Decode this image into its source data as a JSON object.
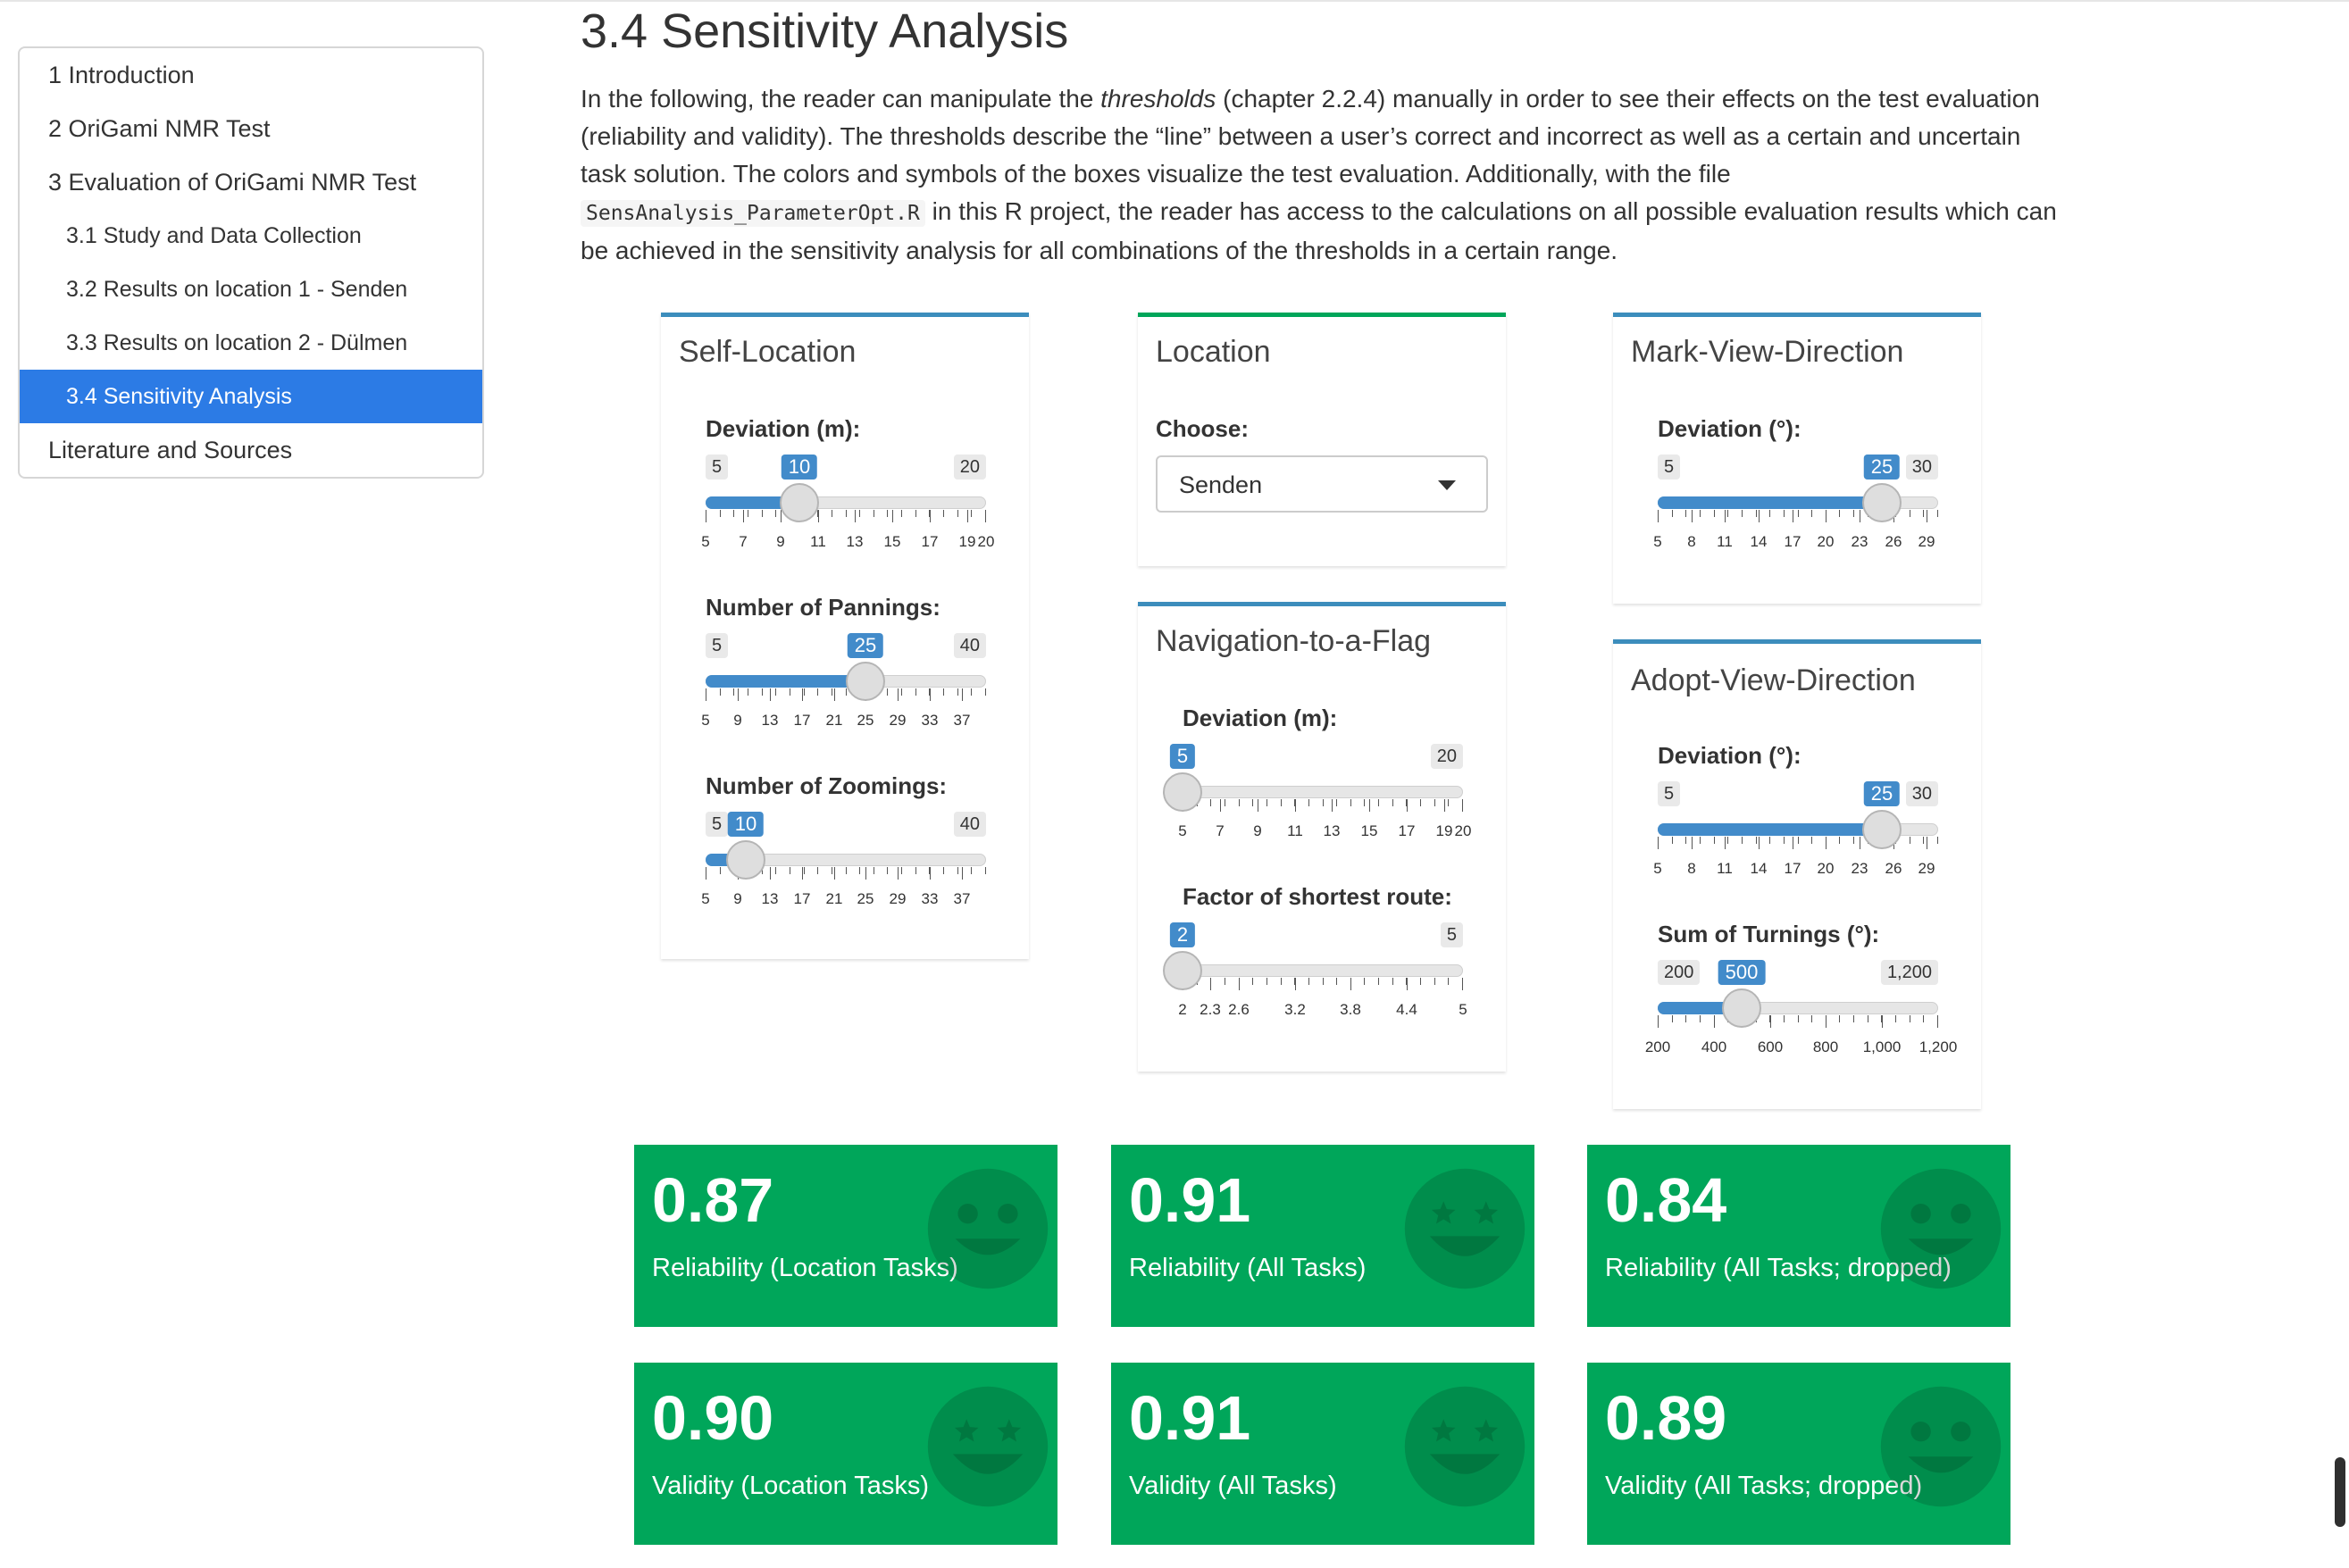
{
  "toc": [
    {
      "label": "1 Introduction",
      "level": 1,
      "active": false
    },
    {
      "label": "2 OriGami NMR Test",
      "level": 1,
      "active": false
    },
    {
      "label": "3 Evaluation of OriGami NMR Test",
      "level": 1,
      "active": false
    },
    {
      "label": "3.1 Study and Data Collection",
      "level": 2,
      "active": false
    },
    {
      "label": "3.2 Results on location 1 - Senden",
      "level": 2,
      "active": false
    },
    {
      "label": "3.3 Results on location 2 - Dülmen",
      "level": 2,
      "active": false
    },
    {
      "label": "3.4 Sensitivity Analysis",
      "level": 2,
      "active": true
    },
    {
      "label": "Literature and Sources",
      "level": 1,
      "active": false
    }
  ],
  "section": {
    "title": "3.4 Sensitivity Analysis",
    "intro": {
      "p1": "In the following, the reader can manipulate the ",
      "em": "thresholds",
      "p2": " (chapter 2.2.4) manually in order to see their effects on the test evaluation (reliability and validity). The thresholds describe the “line” between a user’s correct and incorrect as well as a certain and uncertain task solution. The colors and symbols of the boxes visualize the test evaluation. Additionally, with the file ",
      "code": "SensAnalysis_ParameterOpt.R",
      "p3": " in this R project, the reader has access to the calculations on all possible evaluation results which can be achieved in the sensitivity analysis for all combinations of the thresholds in a certain range."
    }
  },
  "panels": {
    "self_location": {
      "title": "Self-Location",
      "deviation": {
        "label": "Deviation (m):",
        "min": 5,
        "max": 20,
        "value": 10,
        "min_label": "5",
        "max_label": "20",
        "value_label": "10",
        "tick_labels": [
          "5",
          "7",
          "9",
          "11",
          "13",
          "15",
          "17",
          "19",
          "20"
        ],
        "tick_values": [
          5,
          7,
          9,
          11,
          13,
          15,
          17,
          19,
          20
        ]
      },
      "pannings": {
        "label": "Number of Pannings:",
        "min": 5,
        "max": 40,
        "value": 25,
        "min_label": "5",
        "max_label": "40",
        "value_label": "25",
        "tick_labels": [
          "5",
          "9",
          "13",
          "17",
          "21",
          "25",
          "29",
          "33",
          "37"
        ],
        "tick_values": [
          5,
          9,
          13,
          17,
          21,
          25,
          29,
          33,
          37
        ]
      },
      "zoomings": {
        "label": "Number of Zoomings:",
        "min": 5,
        "max": 40,
        "value": 10,
        "min_label": "5",
        "max_label": "40",
        "value_label": "10",
        "tick_labels": [
          "5",
          "9",
          "13",
          "17",
          "21",
          "25",
          "29",
          "33",
          "37"
        ],
        "tick_values": [
          5,
          9,
          13,
          17,
          21,
          25,
          29,
          33,
          37
        ]
      }
    },
    "location": {
      "title": "Location",
      "choose_label": "Choose:",
      "selected": "Senden"
    },
    "nav_flag": {
      "title": "Navigation-to-a-Flag",
      "deviation": {
        "label": "Deviation (m):",
        "min": 5,
        "max": 20,
        "value": 5,
        "min_label": "",
        "max_label": "20",
        "value_label": "5",
        "tick_labels": [
          "5",
          "7",
          "9",
          "11",
          "13",
          "15",
          "17",
          "19",
          "20"
        ],
        "tick_values": [
          5,
          7,
          9,
          11,
          13,
          15,
          17,
          19,
          20
        ]
      },
      "factor": {
        "label": "Factor of shortest route:",
        "min": 2,
        "max": 5,
        "value": 2,
        "min_label": "",
        "max_label": "5",
        "value_label": "2",
        "tick_labels": [
          "2",
          "2.3",
          "2.6",
          "3.2",
          "3.8",
          "4.4",
          "5"
        ],
        "tick_values": [
          2,
          2.3,
          2.6,
          3.2,
          3.8,
          4.4,
          5
        ]
      }
    },
    "mark_view": {
      "title": "Mark-View-Direction",
      "deviation": {
        "label": "Deviation (°):",
        "min": 5,
        "max": 30,
        "value": 25,
        "min_label": "5",
        "max_label": "30",
        "value_label": "25",
        "tick_labels": [
          "5",
          "8",
          "11",
          "14",
          "17",
          "20",
          "23",
          "26",
          "29"
        ],
        "tick_values": [
          5,
          8,
          11,
          14,
          17,
          20,
          23,
          26,
          29
        ]
      }
    },
    "adopt_view": {
      "title": "Adopt-View-Direction",
      "deviation": {
        "label": "Deviation (°):",
        "min": 5,
        "max": 30,
        "value": 25,
        "min_label": "5",
        "max_label": "30",
        "value_label": "25",
        "tick_labels": [
          "5",
          "8",
          "11",
          "14",
          "17",
          "20",
          "23",
          "26",
          "29"
        ],
        "tick_values": [
          5,
          8,
          11,
          14,
          17,
          20,
          23,
          26,
          29
        ]
      },
      "turnings": {
        "label": "Sum of Turnings (°):",
        "min": 200,
        "max": 1200,
        "value": 500,
        "min_label": "200",
        "max_label": "1,200",
        "value_label": "500",
        "tick_labels": [
          "200",
          "400",
          "600",
          "800",
          "1,000",
          "1,200"
        ],
        "tick_values": [
          200,
          400,
          600,
          800,
          1000,
          1200
        ]
      }
    }
  },
  "value_boxes": [
    {
      "value": "0.87",
      "label": "Reliability (Location Tasks)",
      "icon": "smile-icon"
    },
    {
      "value": "0.91",
      "label": "Reliability (All Tasks)",
      "icon": "grin-stars-icon"
    },
    {
      "value": "0.84",
      "label": "Reliability (All Tasks; dropped)",
      "icon": "smile-icon"
    },
    {
      "value": "0.90",
      "label": "Validity (Location Tasks)",
      "icon": "grin-stars-icon"
    },
    {
      "value": "0.91",
      "label": "Validity (All Tasks)",
      "icon": "grin-stars-icon"
    },
    {
      "value": "0.89",
      "label": "Validity (All Tasks; dropped)",
      "icon": "smile-icon"
    }
  ],
  "colors": {
    "accent": "#2c7be5",
    "slider": "#428bca",
    "box_green": "#00a65a",
    "panel_blue": "#3c8dbc"
  }
}
